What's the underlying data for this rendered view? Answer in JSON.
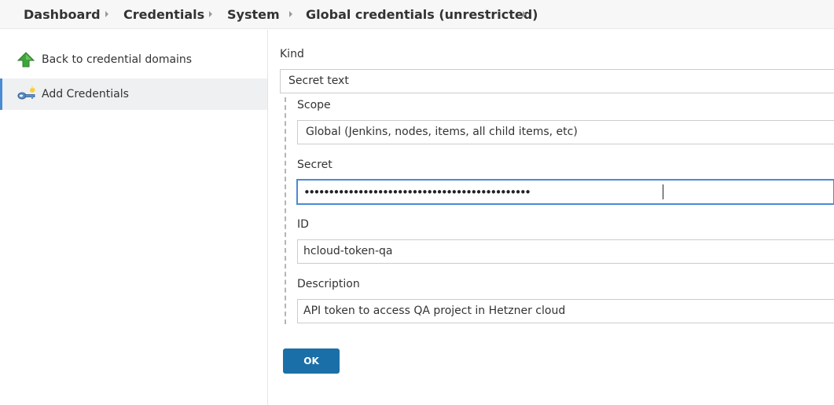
{
  "breadcrumb": {
    "items": [
      "Dashboard",
      "Credentials",
      "System",
      "Global credentials (unrestricted)"
    ]
  },
  "side_panel": {
    "tasks": [
      {
        "label": "Back to credential domains",
        "icon": "up-arrow-icon"
      },
      {
        "label": "Add Credentials",
        "icon": "key-icon",
        "active": true
      }
    ]
  },
  "form": {
    "kind": {
      "label": "Kind",
      "value": "Secret text"
    },
    "scope": {
      "label": "Scope",
      "value": "Global (Jenkins, nodes, items, all child items, etc)"
    },
    "secret": {
      "label": "Secret",
      "value": "••••••••••••••••••••••••••••••••••••••••••••••"
    },
    "id": {
      "label": "ID",
      "value": "hcloud-token-qa"
    },
    "description": {
      "label": "Description",
      "value": "API token to access QA project in Hetzner cloud"
    },
    "ok_label": "OK"
  },
  "colors": {
    "accent": "#4b8ad4",
    "button": "#1b6fa8",
    "arrow_green": "#3fa53a",
    "key_blue": "#5a8fc7"
  }
}
